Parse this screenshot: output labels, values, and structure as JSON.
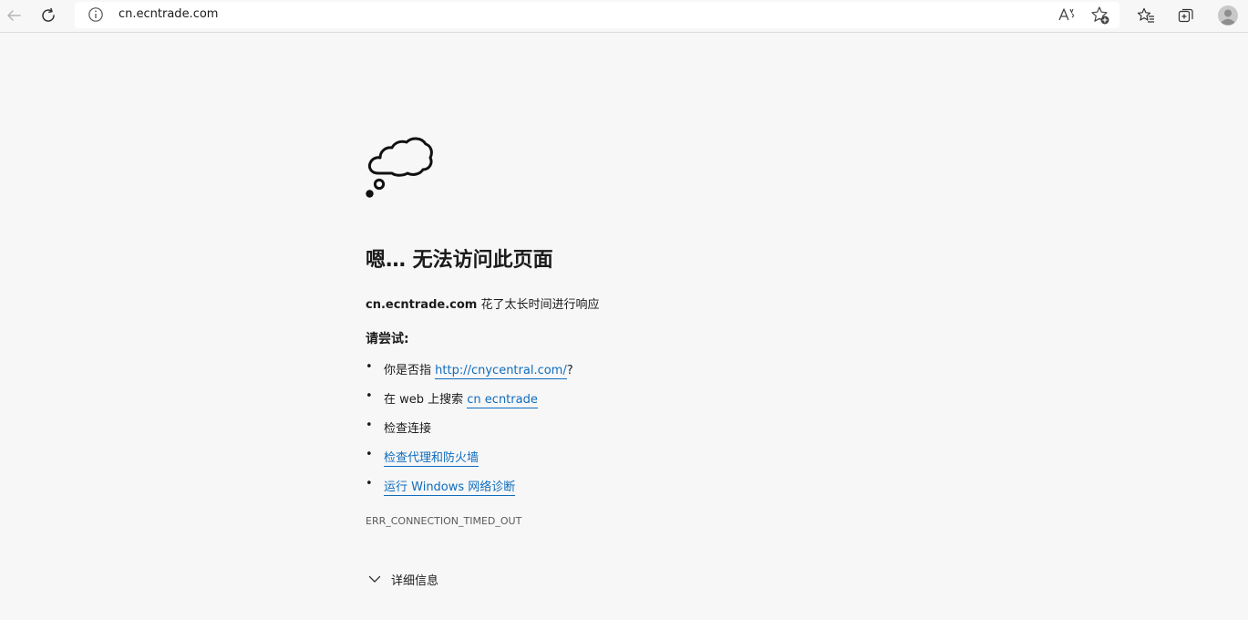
{
  "browser": {
    "address_url": "cn.ecntrade.com",
    "icons": [
      "back-arrow-icon",
      "refresh-icon",
      "info-icon",
      "read-aloud-icon",
      "add-favorite-icon",
      "favorites-icon",
      "collections-icon",
      "profile-avatar-icon"
    ]
  },
  "error_page": {
    "illustration": "thought-cloud-icon",
    "title": "嗯… 无法访问此页面",
    "subtitle_host": "cn.ecntrade.com",
    "subtitle_rest": " 花了太长时间进行响应",
    "try_label": "请尝试:",
    "bullet": "•",
    "suggestions": [
      {
        "prefix": "你是否指 ",
        "link": "http://cnycentral.com/",
        "suffix": "?"
      },
      {
        "prefix": "在 web 上搜索 ",
        "link": "cn ecntrade",
        "suffix": ""
      },
      {
        "text": "检查连接"
      },
      {
        "link": "检查代理和防火墙"
      },
      {
        "link": "运行 Windows 网络诊断"
      }
    ],
    "error_code": "ERR_CONNECTION_TIMED_OUT",
    "details_label": "详细信息"
  },
  "colors": {
    "link": "#0f6cbd",
    "background": "#f7f7f7"
  }
}
